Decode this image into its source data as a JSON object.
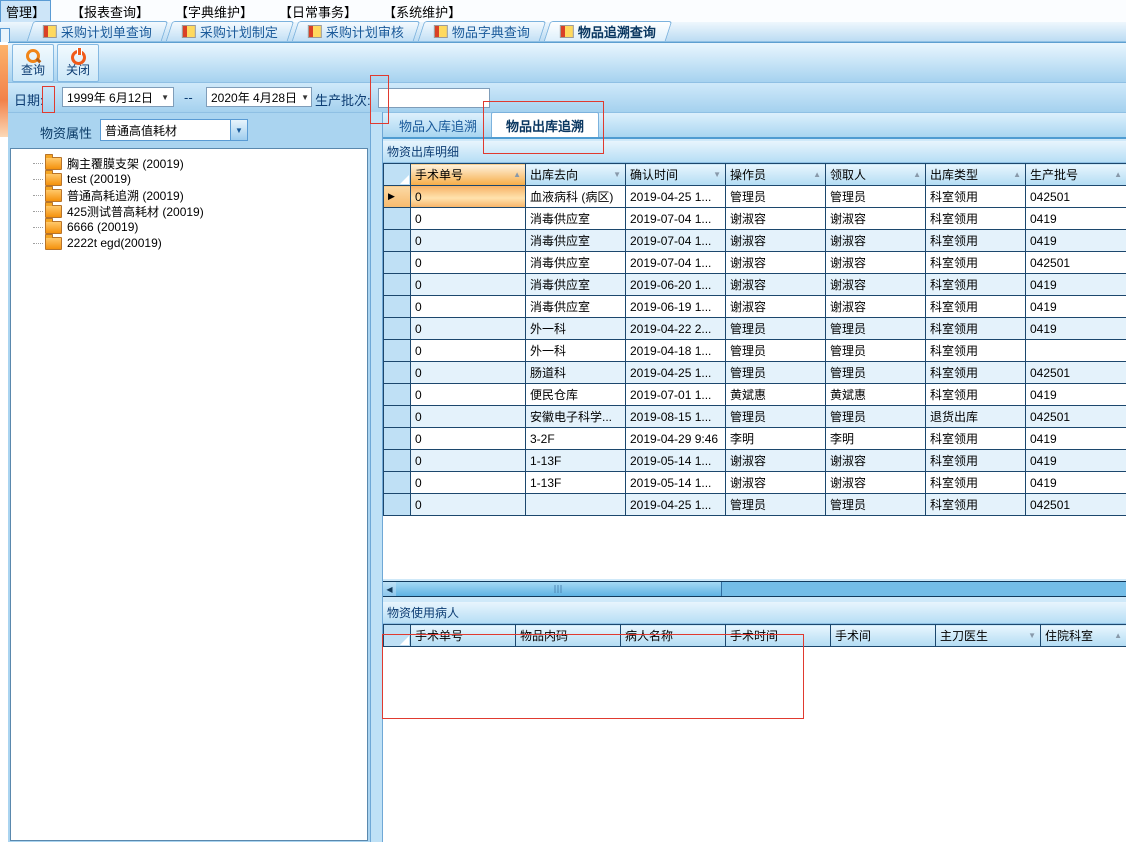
{
  "colors": {
    "annotation_red": "#e03a2f",
    "sorted_header_orange": "#f6ac45",
    "selected_cell_orange": "#f7b367"
  },
  "menu": {
    "items": [
      {
        "label": "管理】",
        "highlighted": true
      },
      {
        "label": "【报表查询】",
        "highlighted": false
      },
      {
        "label": "【字典维护】",
        "highlighted": false
      },
      {
        "label": "【日常事务】",
        "highlighted": false
      },
      {
        "label": "【系统维护】",
        "highlighted": false
      }
    ]
  },
  "window_tabs": {
    "active_index": 4,
    "items": [
      "采购计划单查询",
      "采购计划制定",
      "采购计划审核",
      "物品字典查询",
      "物品追溯查询"
    ]
  },
  "toolbar": {
    "query_label": "查询",
    "close_label": "关闭"
  },
  "filters": {
    "date_label": "日期:",
    "date_from": "1999年 6月12日",
    "date_separator": "--",
    "date_to": "2020年 4月28日",
    "batch_label": "生产批次:",
    "batch_value": ""
  },
  "left_panel": {
    "attr_label": "物资属性",
    "attr_value": "普通高值耗材",
    "tree": [
      "胸主覆膜支架 (20019)",
      "test (20019)",
      "普通高耗追溯 (20019)",
      "425测试普高耗材 (20019)",
      "6666 (20019)",
      "2222t egd(20019)"
    ]
  },
  "right_panel": {
    "tabs": {
      "active_index": 1,
      "items": [
        "物品入库追溯",
        "物品出库追溯"
      ]
    },
    "detail_section_title": "物资出库明细",
    "detail_grid": {
      "columns": [
        {
          "label": "手术单号",
          "sort": "up",
          "sorted": true,
          "width": 115
        },
        {
          "label": "出库去向",
          "sort": "down",
          "sorted": false,
          "width": 100
        },
        {
          "label": "确认时间",
          "sort": "down",
          "sorted": false,
          "width": 100
        },
        {
          "label": "操作员",
          "sort": "up",
          "sorted": false,
          "width": 100
        },
        {
          "label": "领取人",
          "sort": "up",
          "sorted": false,
          "width": 100
        },
        {
          "label": "出库类型",
          "sort": "up",
          "sorted": false,
          "width": 100
        },
        {
          "label": "生产批号",
          "sort": "up",
          "sorted": false,
          "width": 101
        }
      ],
      "selected_row_index": 0,
      "rows": [
        [
          "0",
          "血液病科 (病区)",
          "2019-04-25 1...",
          "管理员",
          "管理员",
          "科室领用",
          "042501"
        ],
        [
          "0",
          "消毒供应室",
          "2019-07-04 1...",
          "谢淑容",
          "谢淑容",
          "科室领用",
          "0419"
        ],
        [
          "0",
          "消毒供应室",
          "2019-07-04 1...",
          "谢淑容",
          "谢淑容",
          "科室领用",
          "0419"
        ],
        [
          "0",
          "消毒供应室",
          "2019-07-04 1...",
          "谢淑容",
          "谢淑容",
          "科室领用",
          "042501"
        ],
        [
          "0",
          "消毒供应室",
          "2019-06-20 1...",
          "谢淑容",
          "谢淑容",
          "科室领用",
          "0419"
        ],
        [
          "0",
          "消毒供应室",
          "2019-06-19 1...",
          "谢淑容",
          "谢淑容",
          "科室领用",
          "0419"
        ],
        [
          "0",
          "外一科",
          "2019-04-22 2...",
          "管理员",
          "管理员",
          "科室领用",
          "0419"
        ],
        [
          "0",
          "外一科",
          "2019-04-18 1...",
          "管理员",
          "管理员",
          "科室领用",
          ""
        ],
        [
          "0",
          "肠道科",
          "2019-04-25 1...",
          "管理员",
          "管理员",
          "科室领用",
          "042501"
        ],
        [
          "0",
          "便民仓库",
          "2019-07-01 1...",
          "黄斌惠",
          "黄斌惠",
          "科室领用",
          "0419"
        ],
        [
          "0",
          "安徽电子科学...",
          "2019-08-15 1...",
          "管理员",
          "管理员",
          "退货出库",
          "042501"
        ],
        [
          "0",
          "3-2F",
          "2019-04-29 9:46",
          "李明",
          "李明",
          "科室领用",
          "0419"
        ],
        [
          "0",
          "1-13F",
          "2019-05-14 1...",
          "谢淑容",
          "谢淑容",
          "科室领用",
          "0419"
        ],
        [
          "0",
          "1-13F",
          "2019-05-14 1...",
          "谢淑容",
          "谢淑容",
          "科室领用",
          "0419"
        ],
        [
          "0",
          "",
          "2019-04-25 1...",
          "管理员",
          "管理员",
          "科室领用",
          "042501"
        ]
      ]
    },
    "patient_section_title": "物资使用病人",
    "patient_grid": {
      "columns": [
        {
          "label": "手术单号",
          "sort": "",
          "sorted": false,
          "width": 105
        },
        {
          "label": "物品内码",
          "sort": "",
          "sorted": false,
          "width": 105
        },
        {
          "label": "病人名称",
          "sort": "",
          "sorted": false,
          "width": 105
        },
        {
          "label": "手术时间",
          "sort": "",
          "sorted": false,
          "width": 105
        },
        {
          "label": "手术间",
          "sort": "",
          "sorted": false,
          "width": 105
        },
        {
          "label": "主刀医生",
          "sort": "down",
          "sorted": false,
          "width": 105
        },
        {
          "label": "住院科室",
          "sort": "up",
          "sorted": false,
          "width": 86
        }
      ],
      "rows": []
    }
  }
}
